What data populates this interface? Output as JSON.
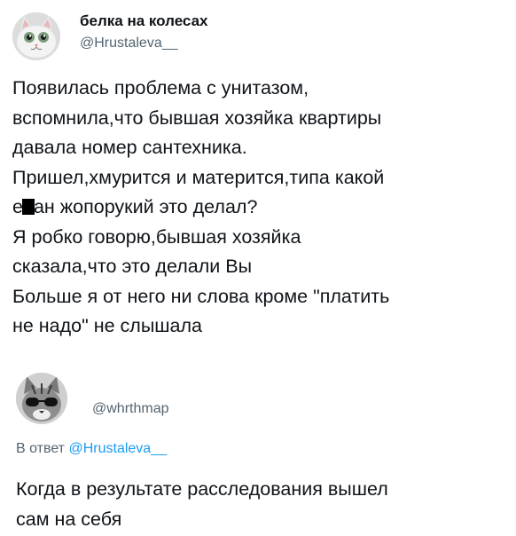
{
  "tweet": {
    "author_name": "белка на колесах",
    "author_handle": "@Hrustaleva__",
    "lines": [
      "Появилась проблема с унитазом,",
      "вспомнила,что бывшая хозяйка квартиры",
      "давала номер сантехника.",
      "Пришел,хмурится и матерится,типа какой",
      [
        "е",
        "ан жопорукий это делал?"
      ],
      "Я робко говорю,бывшая хозяйка",
      "сказала,что это делали Вы",
      "Больше я от него ни слова кроме \"платить",
      "не надо\" не слышала"
    ]
  },
  "reply": {
    "author_handle": "@whrthmap",
    "reply_prefix": "В ответ",
    "reply_to_handle": "@Hrustaleva__",
    "lines": [
      "Когда в результате расследования вышел",
      "сам на себя"
    ]
  }
}
